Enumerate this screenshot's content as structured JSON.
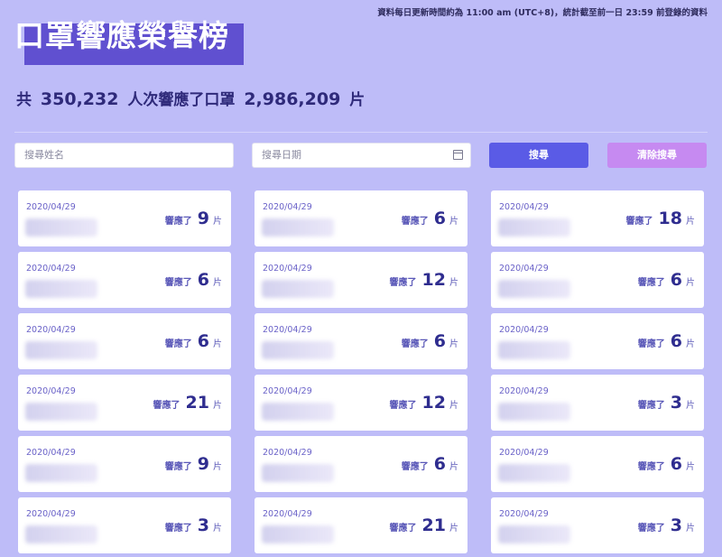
{
  "notice": "資料每日更新時間約為 11:00 am (UTC+8)，統計截至前一日 23:59 前登錄的資料",
  "title": "口罩響應榮譽榜",
  "summary": {
    "prefix": "共",
    "people": "350,232",
    "middle": "人次響應了口罩",
    "masks": "2,986,209",
    "suffix": "片"
  },
  "search": {
    "name_placeholder": "搜尋姓名",
    "date_placeholder": "搜尋日期",
    "search_label": "搜尋",
    "clear_label": "清除搜尋"
  },
  "card_labels": {
    "pre": "響應了",
    "unit": "片"
  },
  "cards": [
    {
      "date": "2020/04/29",
      "count": "9"
    },
    {
      "date": "2020/04/29",
      "count": "6"
    },
    {
      "date": "2020/04/29",
      "count": "18"
    },
    {
      "date": "2020/04/29",
      "count": "6"
    },
    {
      "date": "2020/04/29",
      "count": "12"
    },
    {
      "date": "2020/04/29",
      "count": "6"
    },
    {
      "date": "2020/04/29",
      "count": "6"
    },
    {
      "date": "2020/04/29",
      "count": "6"
    },
    {
      "date": "2020/04/29",
      "count": "6"
    },
    {
      "date": "2020/04/29",
      "count": "21"
    },
    {
      "date": "2020/04/29",
      "count": "12"
    },
    {
      "date": "2020/04/29",
      "count": "3"
    },
    {
      "date": "2020/04/29",
      "count": "9"
    },
    {
      "date": "2020/04/29",
      "count": "6"
    },
    {
      "date": "2020/04/29",
      "count": "6"
    },
    {
      "date": "2020/04/29",
      "count": "3"
    },
    {
      "date": "2020/04/29",
      "count": "21"
    },
    {
      "date": "2020/04/29",
      "count": "3"
    }
  ]
}
